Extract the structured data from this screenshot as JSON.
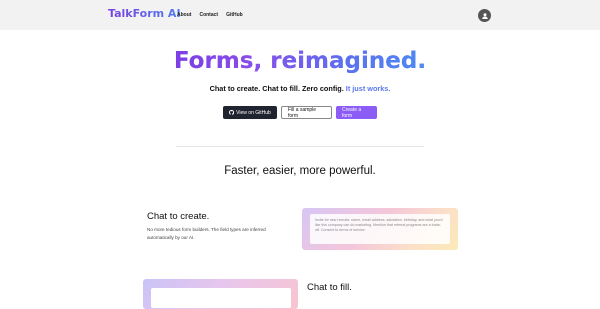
{
  "header": {
    "brand": "TalkForm AI",
    "nav": [
      {
        "label": "About"
      },
      {
        "label": "Contact"
      },
      {
        "label": "GitHub"
      }
    ],
    "avatar_icon": "user-icon"
  },
  "hero": {
    "title": "Forms, reimagined.",
    "tagline_main": "Chat to create. Chat to fill. Zero config. ",
    "tagline_accent": "It just works.",
    "buttons": {
      "github": "View on GitHub",
      "sample": "Fill a sample form",
      "create": "Create a form"
    }
  },
  "subheading": "Faster, easier, more powerful.",
  "features": {
    "create": {
      "title": "Chat to create.",
      "description": "No more tedious form builders. The field types are inferred automatically by our AI.",
      "example_prompt": "Invite for new recruits: name, email address, salutation, birthday, and what you'd like this company can do marketing. Mention that referral programs are a trade-off. Consent to terms of service."
    },
    "fill": {
      "title": "Chat to fill."
    }
  },
  "colors": {
    "brand_gradient_start": "#7b3fe4",
    "brand_gradient_end": "#4d8bf2",
    "accent_blue": "#5b78ef",
    "primary_purple": "#8b5cf6",
    "dark_button": "#1f2430"
  }
}
